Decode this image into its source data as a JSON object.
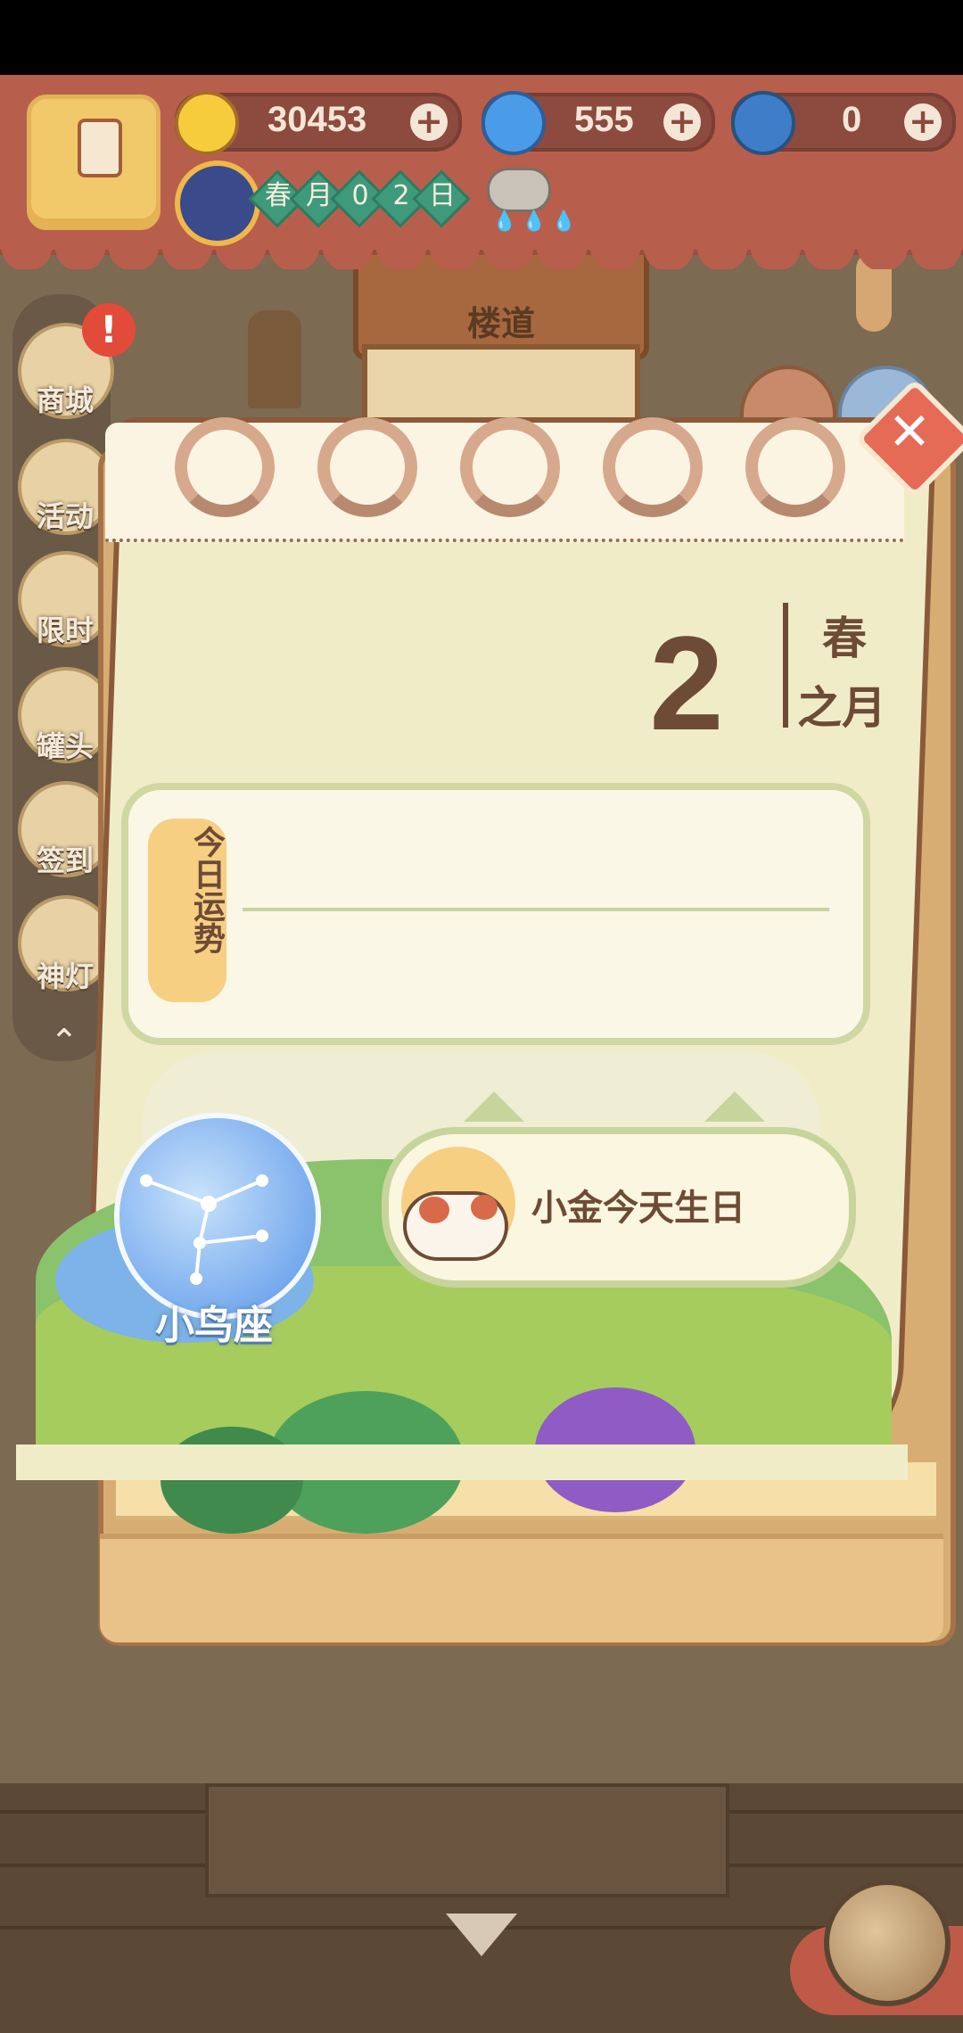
{
  "hud": {
    "bananas": "30453",
    "gems": "555",
    "golden_bananas": "0",
    "date": {
      "season": "春",
      "month_word": "月",
      "d1": "0",
      "d2": "2",
      "day_word": "日"
    },
    "weather": "rain-cloud-icon"
  },
  "scene": {
    "sign_label": "楼道",
    "side_menu": [
      {
        "label": "商城"
      },
      {
        "label": "活动"
      },
      {
        "label": "限时"
      },
      {
        "label": "罐头"
      },
      {
        "label": "签到"
      },
      {
        "label": "神灯"
      }
    ]
  },
  "calendar": {
    "day": "2",
    "season": "春",
    "month_suffix": "之月",
    "fortune_label": "今日运势",
    "fortune_text": "",
    "constellation": "小鸟座",
    "birthday_text": "小金今天生日"
  },
  "colors": {
    "hud_bg": "#b85e4d",
    "page_border": "#8a5a3b",
    "close_button": "#e56b56",
    "constellation_blue": "#6ea4ec"
  }
}
